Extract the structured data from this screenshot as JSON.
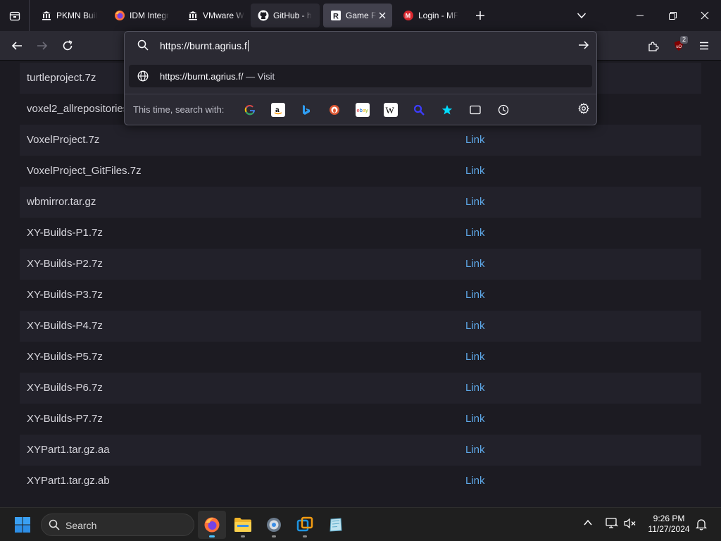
{
  "tabs": [
    {
      "label": "PKMN Buil",
      "icon": "bank-icon"
    },
    {
      "label": "IDM Integr",
      "icon": "firefox-icon"
    },
    {
      "label": "VMware W",
      "icon": "bank-icon"
    },
    {
      "label": "GitHub - h",
      "icon": "github-icon"
    },
    {
      "label": "Game Fr",
      "icon": "r-logo-icon",
      "active": true
    },
    {
      "label": "Login - MF",
      "icon": "mega-icon"
    }
  ],
  "addon_badge": "2",
  "url_popup": {
    "input_value": "https://burnt.agrius.f",
    "suggestion_url": "https://burnt.agrius.f/",
    "suggestion_action": "— Visit",
    "search_with_label": "This time, search with:",
    "engines": [
      "google-icon",
      "amazon-icon",
      "bing-icon",
      "duckduckgo-icon",
      "ebay-icon",
      "wikipedia-icon",
      "search-engine-icon",
      "bookmarks-icon",
      "tabs-icon",
      "history-icon"
    ]
  },
  "files": [
    {
      "name": "turtleproject.7z",
      "link": ""
    },
    {
      "name": "voxel2_allrepositories",
      "link": ""
    },
    {
      "name": "VoxelProject.7z",
      "link": "Link"
    },
    {
      "name": "VoxelProject_GitFiles.7z",
      "link": "Link"
    },
    {
      "name": "wbmirror.tar.gz",
      "link": "Link"
    },
    {
      "name": "XY-Builds-P1.7z",
      "link": "Link"
    },
    {
      "name": "XY-Builds-P2.7z",
      "link": "Link"
    },
    {
      "name": "XY-Builds-P3.7z",
      "link": "Link"
    },
    {
      "name": "XY-Builds-P4.7z",
      "link": "Link"
    },
    {
      "name": "XY-Builds-P5.7z",
      "link": "Link"
    },
    {
      "name": "XY-Builds-P6.7z",
      "link": "Link"
    },
    {
      "name": "XY-Builds-P7.7z",
      "link": "Link"
    },
    {
      "name": "XYPart1.tar.gz.aa",
      "link": "Link"
    },
    {
      "name": "XYPart1.tar.gz.ab",
      "link": "Link"
    }
  ],
  "taskbar": {
    "search_label": "Search",
    "time": "9:26 PM",
    "date": "11/27/2024"
  },
  "colors": {
    "accent": "#4cc2ff",
    "link": "#5ea8e8",
    "background": "#1c1b22"
  }
}
